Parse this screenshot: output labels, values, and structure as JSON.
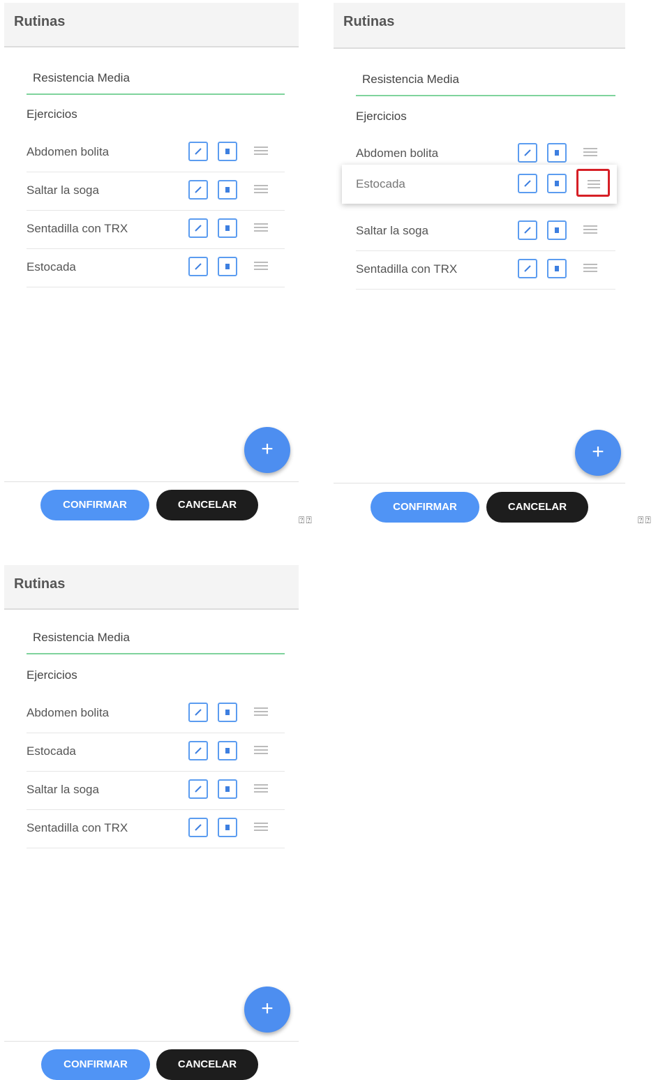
{
  "app": {
    "title": "Rutinas"
  },
  "routine": {
    "name": "Resistencia Media",
    "section_label": "Ejercicios"
  },
  "buttons": {
    "confirm": "CONFIRMAR",
    "cancel": "CANCELAR",
    "add": "+"
  },
  "screens": [
    {
      "exercises": [
        "Abdomen bolita",
        "Saltar la soga",
        "Sentadilla con TRX",
        "Estocada"
      ]
    },
    {
      "exercises": [
        "Abdomen bolita",
        "Saltar la soga",
        "Sentadilla con TRX"
      ],
      "dragging": "Estocada"
    },
    {
      "exercises": [
        "Abdomen bolita",
        "Estocada",
        "Saltar la soga",
        "Sentadilla con TRX"
      ]
    }
  ],
  "icons": {
    "edit": "pencil-icon",
    "delete": "trash-icon",
    "drag": "drag-handle-icon",
    "add": "plus-icon"
  },
  "colors": {
    "accent": "#5094f5",
    "underline": "#7fd39c",
    "highlight": "#d61f26"
  },
  "separator_glyphs": "⍰⍰"
}
